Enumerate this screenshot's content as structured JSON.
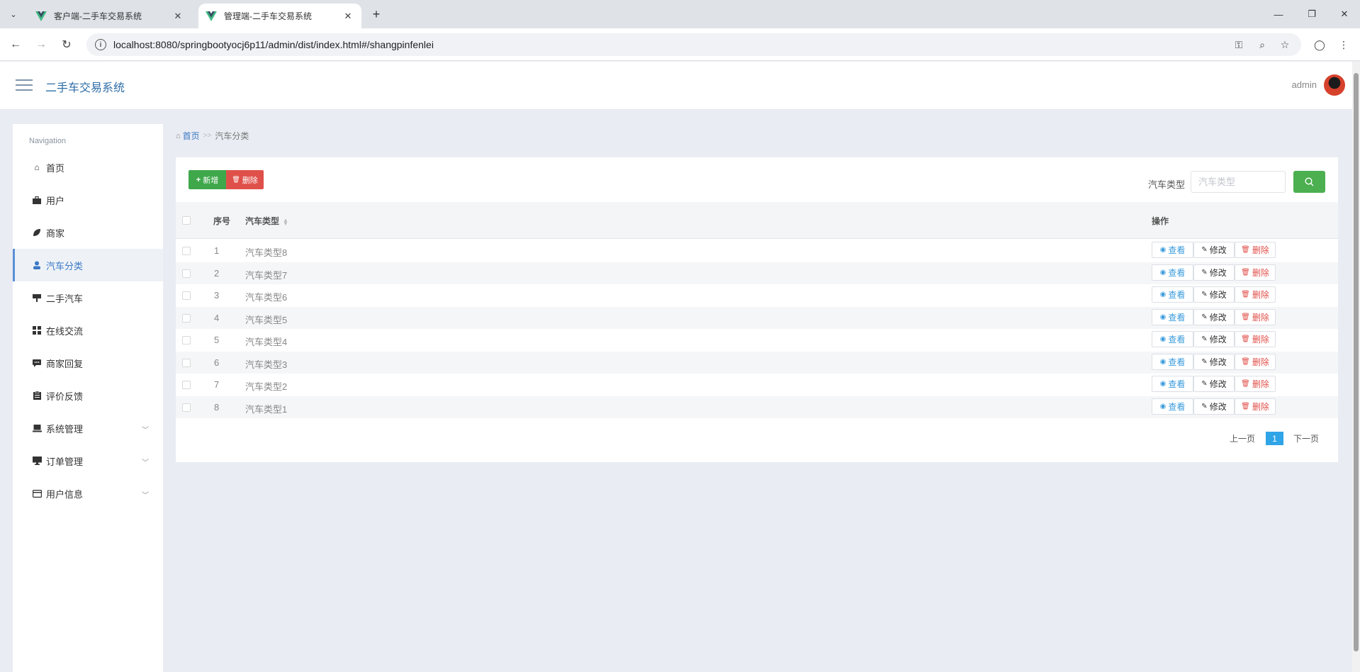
{
  "browser": {
    "tabs": [
      {
        "title": "客户端-二手车交易系统",
        "active": false
      },
      {
        "title": "管理端-二手车交易系统",
        "active": true
      }
    ],
    "url": "localhost:8080/springbootyocj6p11/admin/dist/index.html#/shangpinfenlei"
  },
  "header": {
    "app_title": "二手车交易系统",
    "user_name": "admin"
  },
  "sidebar": {
    "heading": "Navigation",
    "items": [
      {
        "label": "首页",
        "icon": "home-icon"
      },
      {
        "label": "用户",
        "icon": "briefcase-icon"
      },
      {
        "label": "商家",
        "icon": "leaf-icon"
      },
      {
        "label": "汽车分类",
        "icon": "person-icon",
        "active": true
      },
      {
        "label": "二手汽车",
        "icon": "sign-icon"
      },
      {
        "label": "在线交流",
        "icon": "grid-icon"
      },
      {
        "label": "商家回复",
        "icon": "chat-icon"
      },
      {
        "label": "评价反馈",
        "icon": "clipboard-icon"
      },
      {
        "label": "系统管理",
        "icon": "laptop-icon",
        "expandable": true
      },
      {
        "label": "订单管理",
        "icon": "monitor-icon",
        "expandable": true
      },
      {
        "label": "用户信息",
        "icon": "card-icon",
        "expandable": true
      }
    ]
  },
  "breadcrumb": {
    "home": "首页",
    "separator": ">>",
    "current": "汽车分类"
  },
  "toolbar": {
    "add_label": "新增",
    "delete_label": "删除",
    "search_label": "汽车类型",
    "search_placeholder": "汽车类型"
  },
  "table": {
    "columns": {
      "index": "序号",
      "type": "汽车类型",
      "actions": "操作"
    },
    "action_labels": {
      "view": "查看",
      "edit": "修改",
      "delete": "删除"
    },
    "rows": [
      {
        "index": "1",
        "type": "汽车类型8"
      },
      {
        "index": "2",
        "type": "汽车类型7"
      },
      {
        "index": "3",
        "type": "汽车类型6"
      },
      {
        "index": "4",
        "type": "汽车类型5"
      },
      {
        "index": "5",
        "type": "汽车类型4"
      },
      {
        "index": "6",
        "type": "汽车类型3"
      },
      {
        "index": "7",
        "type": "汽车类型2"
      },
      {
        "index": "8",
        "type": "汽车类型1"
      }
    ]
  },
  "pagination": {
    "prev": "上一页",
    "current": "1",
    "next": "下一页"
  },
  "colors": {
    "accent": "#3a78c4",
    "add_button": "#3fa84b",
    "delete_button": "#e0504a",
    "search_button": "#4caf50",
    "page_active": "#2fa4e7"
  }
}
